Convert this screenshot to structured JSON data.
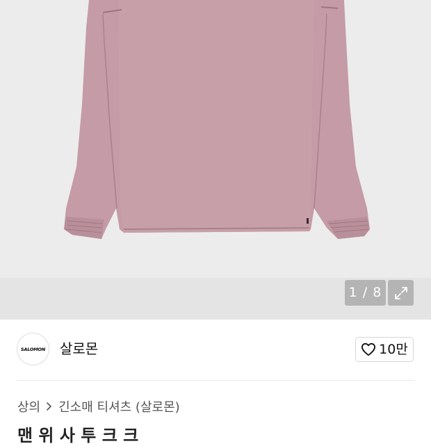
{
  "gallery": {
    "counter": "1 / 8",
    "expand_icon": "expand-arrows-icon",
    "image_icon": "pink-jacket-product-photo"
  },
  "brand": {
    "logo_text": "SALOMON",
    "name": "살로몬"
  },
  "like": {
    "icon": "heart-outline-icon",
    "count": "10만"
  },
  "breadcrumb": {
    "items": [
      "상의",
      "긴소매 티셔츠 (살로몬)"
    ],
    "separator_icon": "chevron-right-icon"
  },
  "product": {
    "title_partial": "맨 위 사 투 크 크"
  },
  "colors": {
    "jacket": "#c39aa5",
    "gallery_bg": "#ececec"
  }
}
